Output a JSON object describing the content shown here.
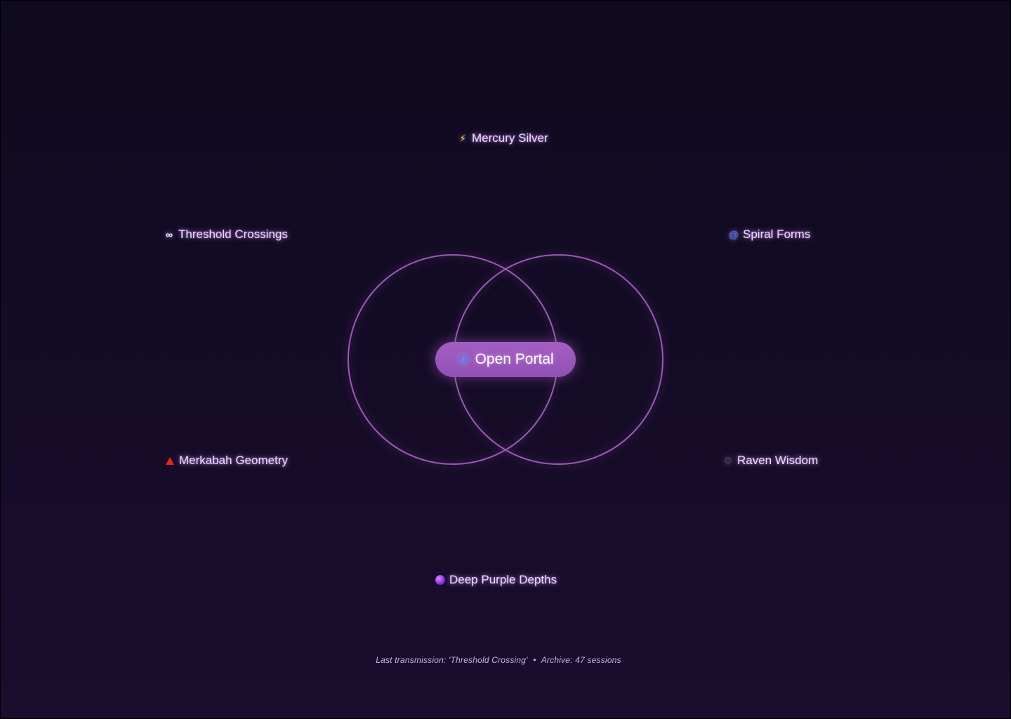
{
  "portal": {
    "label": "Open Portal",
    "icon": "spiral-icon"
  },
  "nodes": [
    {
      "label": "Mercury Silver",
      "icon": "lightning-icon"
    },
    {
      "label": "Threshold Crossings",
      "icon": "infinity-icon"
    },
    {
      "label": "Spiral Forms",
      "icon": "spiral-icon"
    },
    {
      "label": "Merkabah Geometry",
      "icon": "red-triangle-icon"
    },
    {
      "label": "Raven Wisdom",
      "icon": "black-heart-icon"
    },
    {
      "label": "Deep Purple Depths",
      "icon": "purple-orb-icon"
    }
  ],
  "footer": {
    "last_transmission": "Last transmission: 'Threshold Crossing'",
    "separator": "•",
    "archive": "Archive: 47 sessions"
  },
  "colors": {
    "background_top": "#0f0a1f",
    "background_bottom": "#1a0d2e",
    "accent": "#9b59b6",
    "text_glow": "#e9d5ff"
  }
}
